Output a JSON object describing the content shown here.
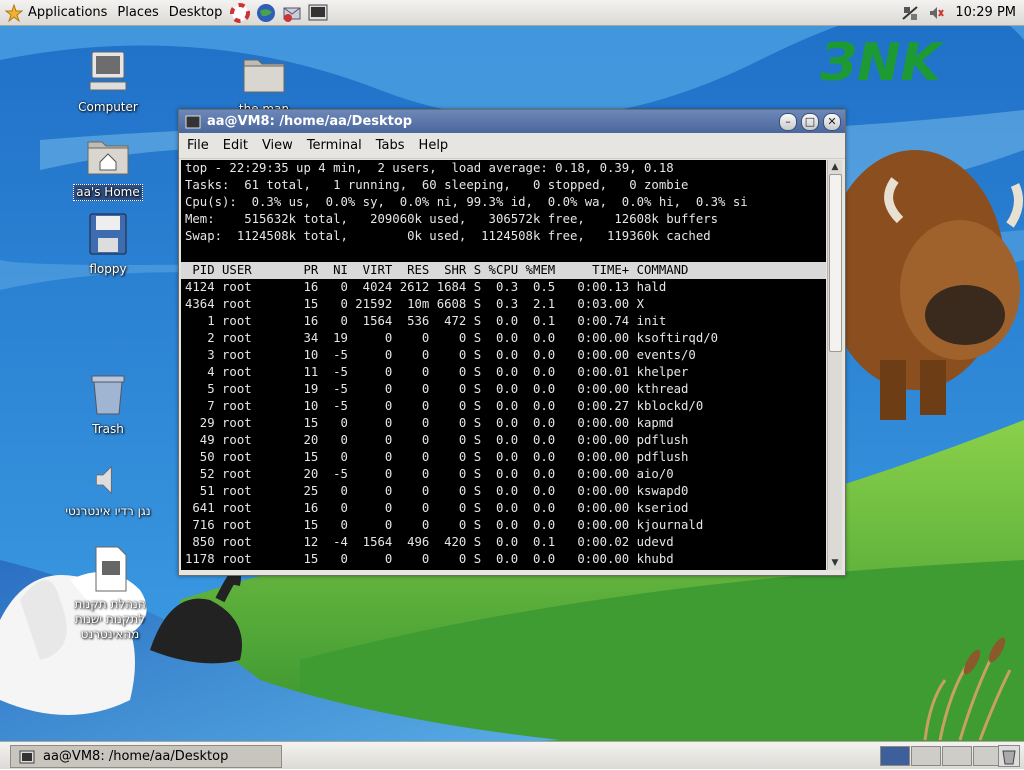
{
  "top_panel": {
    "menus": [
      "Applications",
      "Places",
      "Desktop"
    ],
    "clock": "10:29 PM"
  },
  "desktop": {
    "logo_text": "ЗNK",
    "icons": [
      {
        "label": "Computer",
        "icon": "computer-icon"
      },
      {
        "label": "the man",
        "icon": "folder-icon"
      },
      {
        "label": "aa's Home",
        "icon": "home-folder-icon"
      },
      {
        "label": "floppy",
        "icon": "floppy-icon"
      },
      {
        "label": "Trash",
        "icon": "trash-icon"
      },
      {
        "label": "נגן רדיו אינטרנטי",
        "icon": "speaker-icon"
      },
      {
        "label": "הנהלת תקנות לתקנות ישנות מהאינטרנט",
        "icon": "document-icon"
      }
    ]
  },
  "terminal": {
    "title": "aa@VM8: /home/aa/Desktop",
    "menu": [
      "File",
      "Edit",
      "View",
      "Terminal",
      "Tabs",
      "Help"
    ],
    "summary": [
      "top - 22:29:35 up 4 min,  2 users,  load average: 0.18, 0.39, 0.18",
      "Tasks:  61 total,   1 running,  60 sleeping,   0 stopped,   0 zombie",
      "Cpu(s):  0.3% us,  0.0% sy,  0.0% ni, 99.3% id,  0.0% wa,  0.0% hi,  0.3% si",
      "Mem:    515632k total,   209060k used,   306572k free,    12608k buffers",
      "Swap:  1124508k total,        0k used,  1124508k free,   119360k cached"
    ],
    "columns": [
      "PID",
      "USER",
      "PR",
      "NI",
      "VIRT",
      "RES",
      "SHR",
      "S",
      "%CPU",
      "%MEM",
      "TIME+",
      "COMMAND"
    ],
    "processes": [
      [
        "4124",
        "root",
        "16",
        "0",
        "4024",
        "2612",
        "1684",
        "S",
        "0.3",
        "0.5",
        "0:00.13",
        "hald"
      ],
      [
        "4364",
        "root",
        "15",
        "0",
        "21592",
        "10m",
        "6608",
        "S",
        "0.3",
        "2.1",
        "0:03.00",
        "X"
      ],
      [
        "1",
        "root",
        "16",
        "0",
        "1564",
        "536",
        "472",
        "S",
        "0.0",
        "0.1",
        "0:00.74",
        "init"
      ],
      [
        "2",
        "root",
        "34",
        "19",
        "0",
        "0",
        "0",
        "S",
        "0.0",
        "0.0",
        "0:00.00",
        "ksoftirqd/0"
      ],
      [
        "3",
        "root",
        "10",
        "-5",
        "0",
        "0",
        "0",
        "S",
        "0.0",
        "0.0",
        "0:00.00",
        "events/0"
      ],
      [
        "4",
        "root",
        "11",
        "-5",
        "0",
        "0",
        "0",
        "S",
        "0.0",
        "0.0",
        "0:00.01",
        "khelper"
      ],
      [
        "5",
        "root",
        "19",
        "-5",
        "0",
        "0",
        "0",
        "S",
        "0.0",
        "0.0",
        "0:00.00",
        "kthread"
      ],
      [
        "7",
        "root",
        "10",
        "-5",
        "0",
        "0",
        "0",
        "S",
        "0.0",
        "0.0",
        "0:00.27",
        "kblockd/0"
      ],
      [
        "29",
        "root",
        "15",
        "0",
        "0",
        "0",
        "0",
        "S",
        "0.0",
        "0.0",
        "0:00.00",
        "kapmd"
      ],
      [
        "49",
        "root",
        "20",
        "0",
        "0",
        "0",
        "0",
        "S",
        "0.0",
        "0.0",
        "0:00.00",
        "pdflush"
      ],
      [
        "50",
        "root",
        "15",
        "0",
        "0",
        "0",
        "0",
        "S",
        "0.0",
        "0.0",
        "0:00.00",
        "pdflush"
      ],
      [
        "52",
        "root",
        "20",
        "-5",
        "0",
        "0",
        "0",
        "S",
        "0.0",
        "0.0",
        "0:00.00",
        "aio/0"
      ],
      [
        "51",
        "root",
        "25",
        "0",
        "0",
        "0",
        "0",
        "S",
        "0.0",
        "0.0",
        "0:00.00",
        "kswapd0"
      ],
      [
        "641",
        "root",
        "16",
        "0",
        "0",
        "0",
        "0",
        "S",
        "0.0",
        "0.0",
        "0:00.00",
        "kseriod"
      ],
      [
        "716",
        "root",
        "15",
        "0",
        "0",
        "0",
        "0",
        "S",
        "0.0",
        "0.0",
        "0:00.00",
        "kjournald"
      ],
      [
        "850",
        "root",
        "12",
        "-4",
        "1564",
        "496",
        "420",
        "S",
        "0.0",
        "0.1",
        "0:00.02",
        "udevd"
      ],
      [
        "1178",
        "root",
        "15",
        "0",
        "0",
        "0",
        "0",
        "S",
        "0.0",
        "0.0",
        "0:00.00",
        "khubd"
      ]
    ]
  },
  "taskbar": {
    "task_label": "aa@VM8: /home/aa/Desktop",
    "workspace_count": 4,
    "active_workspace": 1
  },
  "colors": {
    "sky": "#2f86d8",
    "grass": "#53b43a",
    "titlebar": "#5a77aa",
    "terminal_bg": "#000000"
  }
}
